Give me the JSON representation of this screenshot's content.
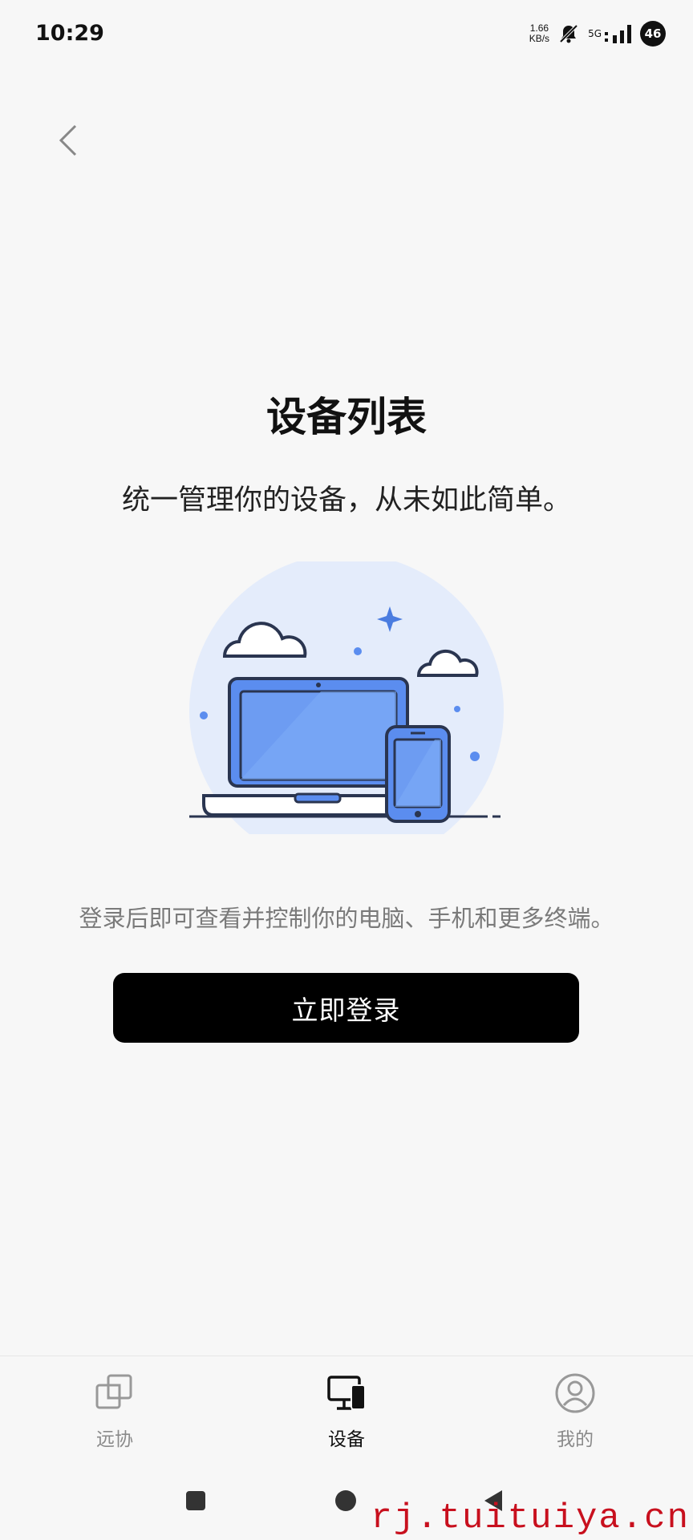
{
  "status_bar": {
    "time": "10:29",
    "net_speed_value": "1.66",
    "net_speed_unit": "KB/s",
    "signal_label": "5G",
    "battery": "46"
  },
  "page": {
    "title": "设备列表",
    "subtitle": "统一管理你的设备，从未如此简单。",
    "hint": "登录后即可查看并控制你的电脑、手机和更多终端。",
    "login_button": "立即登录"
  },
  "tabbar": {
    "tabs": [
      {
        "label": "远协",
        "icon": "remote-assist-icon",
        "active": false
      },
      {
        "label": "设备",
        "icon": "devices-icon",
        "active": true
      },
      {
        "label": "我的",
        "icon": "profile-icon",
        "active": false
      }
    ]
  },
  "watermark": "rj.tuituiya.cn",
  "colors": {
    "accent": "#000000",
    "illustration_blue": "#5b8def",
    "illustration_bg": "#e4ecfb"
  }
}
